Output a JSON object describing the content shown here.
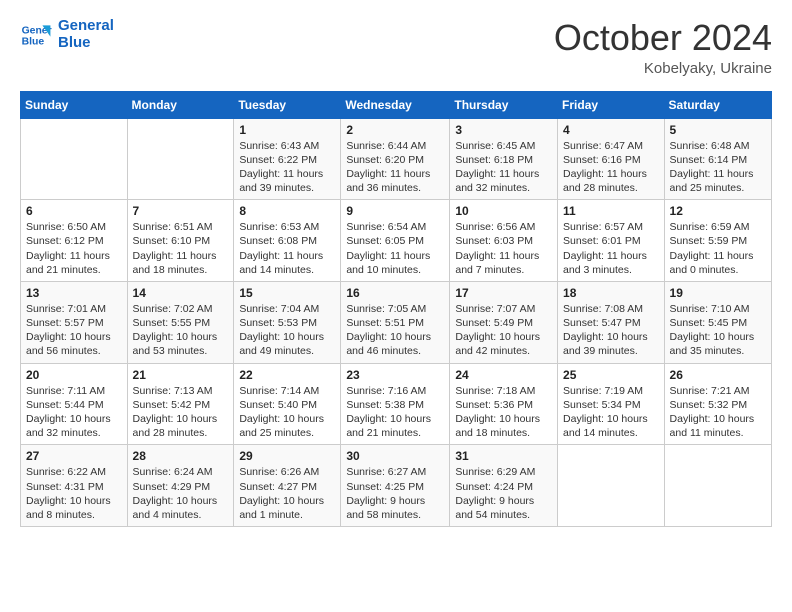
{
  "header": {
    "logo_line1": "General",
    "logo_line2": "Blue",
    "main_title": "October 2024",
    "subtitle": "Kobelyaky, Ukraine"
  },
  "columns": [
    "Sunday",
    "Monday",
    "Tuesday",
    "Wednesday",
    "Thursday",
    "Friday",
    "Saturday"
  ],
  "weeks": [
    [
      {
        "day": "",
        "info": ""
      },
      {
        "day": "",
        "info": ""
      },
      {
        "day": "1",
        "info": "Sunrise: 6:43 AM\nSunset: 6:22 PM\nDaylight: 11 hours and 39 minutes."
      },
      {
        "day": "2",
        "info": "Sunrise: 6:44 AM\nSunset: 6:20 PM\nDaylight: 11 hours and 36 minutes."
      },
      {
        "day": "3",
        "info": "Sunrise: 6:45 AM\nSunset: 6:18 PM\nDaylight: 11 hours and 32 minutes."
      },
      {
        "day": "4",
        "info": "Sunrise: 6:47 AM\nSunset: 6:16 PM\nDaylight: 11 hours and 28 minutes."
      },
      {
        "day": "5",
        "info": "Sunrise: 6:48 AM\nSunset: 6:14 PM\nDaylight: 11 hours and 25 minutes."
      }
    ],
    [
      {
        "day": "6",
        "info": "Sunrise: 6:50 AM\nSunset: 6:12 PM\nDaylight: 11 hours and 21 minutes."
      },
      {
        "day": "7",
        "info": "Sunrise: 6:51 AM\nSunset: 6:10 PM\nDaylight: 11 hours and 18 minutes."
      },
      {
        "day": "8",
        "info": "Sunrise: 6:53 AM\nSunset: 6:08 PM\nDaylight: 11 hours and 14 minutes."
      },
      {
        "day": "9",
        "info": "Sunrise: 6:54 AM\nSunset: 6:05 PM\nDaylight: 11 hours and 10 minutes."
      },
      {
        "day": "10",
        "info": "Sunrise: 6:56 AM\nSunset: 6:03 PM\nDaylight: 11 hours and 7 minutes."
      },
      {
        "day": "11",
        "info": "Sunrise: 6:57 AM\nSunset: 6:01 PM\nDaylight: 11 hours and 3 minutes."
      },
      {
        "day": "12",
        "info": "Sunrise: 6:59 AM\nSunset: 5:59 PM\nDaylight: 11 hours and 0 minutes."
      }
    ],
    [
      {
        "day": "13",
        "info": "Sunrise: 7:01 AM\nSunset: 5:57 PM\nDaylight: 10 hours and 56 minutes."
      },
      {
        "day": "14",
        "info": "Sunrise: 7:02 AM\nSunset: 5:55 PM\nDaylight: 10 hours and 53 minutes."
      },
      {
        "day": "15",
        "info": "Sunrise: 7:04 AM\nSunset: 5:53 PM\nDaylight: 10 hours and 49 minutes."
      },
      {
        "day": "16",
        "info": "Sunrise: 7:05 AM\nSunset: 5:51 PM\nDaylight: 10 hours and 46 minutes."
      },
      {
        "day": "17",
        "info": "Sunrise: 7:07 AM\nSunset: 5:49 PM\nDaylight: 10 hours and 42 minutes."
      },
      {
        "day": "18",
        "info": "Sunrise: 7:08 AM\nSunset: 5:47 PM\nDaylight: 10 hours and 39 minutes."
      },
      {
        "day": "19",
        "info": "Sunrise: 7:10 AM\nSunset: 5:45 PM\nDaylight: 10 hours and 35 minutes."
      }
    ],
    [
      {
        "day": "20",
        "info": "Sunrise: 7:11 AM\nSunset: 5:44 PM\nDaylight: 10 hours and 32 minutes."
      },
      {
        "day": "21",
        "info": "Sunrise: 7:13 AM\nSunset: 5:42 PM\nDaylight: 10 hours and 28 minutes."
      },
      {
        "day": "22",
        "info": "Sunrise: 7:14 AM\nSunset: 5:40 PM\nDaylight: 10 hours and 25 minutes."
      },
      {
        "day": "23",
        "info": "Sunrise: 7:16 AM\nSunset: 5:38 PM\nDaylight: 10 hours and 21 minutes."
      },
      {
        "day": "24",
        "info": "Sunrise: 7:18 AM\nSunset: 5:36 PM\nDaylight: 10 hours and 18 minutes."
      },
      {
        "day": "25",
        "info": "Sunrise: 7:19 AM\nSunset: 5:34 PM\nDaylight: 10 hours and 14 minutes."
      },
      {
        "day": "26",
        "info": "Sunrise: 7:21 AM\nSunset: 5:32 PM\nDaylight: 10 hours and 11 minutes."
      }
    ],
    [
      {
        "day": "27",
        "info": "Sunrise: 6:22 AM\nSunset: 4:31 PM\nDaylight: 10 hours and 8 minutes."
      },
      {
        "day": "28",
        "info": "Sunrise: 6:24 AM\nSunset: 4:29 PM\nDaylight: 10 hours and 4 minutes."
      },
      {
        "day": "29",
        "info": "Sunrise: 6:26 AM\nSunset: 4:27 PM\nDaylight: 10 hours and 1 minute."
      },
      {
        "day": "30",
        "info": "Sunrise: 6:27 AM\nSunset: 4:25 PM\nDaylight: 9 hours and 58 minutes."
      },
      {
        "day": "31",
        "info": "Sunrise: 6:29 AM\nSunset: 4:24 PM\nDaylight: 9 hours and 54 minutes."
      },
      {
        "day": "",
        "info": ""
      },
      {
        "day": "",
        "info": ""
      }
    ]
  ]
}
